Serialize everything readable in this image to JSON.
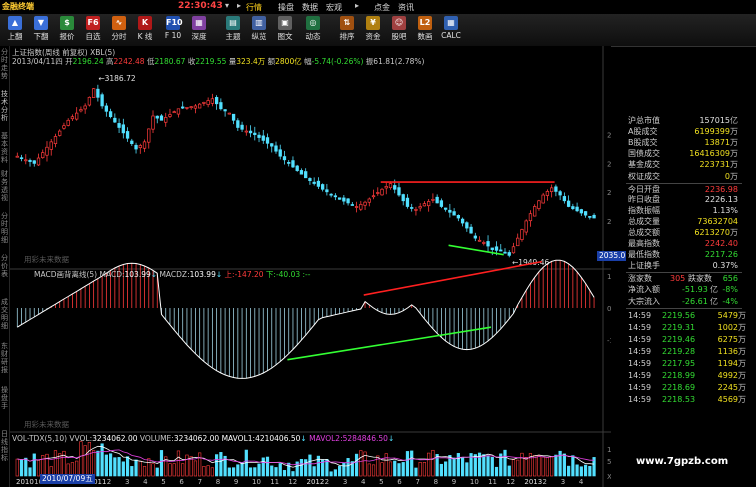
{
  "app": {
    "title": "金融终端",
    "clock": "22:30:43"
  },
  "menu": [
    {
      "label": "行情",
      "active": true
    },
    {
      "label": "操盘",
      "active": false
    },
    {
      "label": "数据",
      "active": false
    },
    {
      "label": "宏观",
      "active": false
    },
    {
      "label": "点金",
      "active": false
    },
    {
      "label": "资讯",
      "active": false
    }
  ],
  "toolbar": [
    {
      "label": "上翻",
      "icon": "page-up-icon",
      "glyph": "▲",
      "color": "#3a6fd8"
    },
    {
      "label": "下翻",
      "icon": "page-down-icon",
      "glyph": "▼",
      "color": "#3a6fd8"
    },
    {
      "label": "报价",
      "icon": "quote-icon",
      "glyph": "$",
      "color": "#2a8a3a"
    },
    {
      "label": "自选",
      "icon": "favorites-icon",
      "glyph": "F6",
      "color": "#c02020"
    },
    {
      "label": "分时",
      "icon": "timeshare-icon",
      "glyph": "∿",
      "color": "#d06010"
    },
    {
      "label": "K 线",
      "icon": "kline-icon",
      "glyph": "K",
      "color": "#b01818"
    },
    {
      "label": "F 10",
      "icon": "f10-icon",
      "glyph": "F10",
      "color": "#2050b0"
    },
    {
      "label": "深度",
      "icon": "depth-icon",
      "glyph": "▦",
      "color": "#8040a0"
    },
    {
      "label": "主题",
      "icon": "theme-icon",
      "glyph": "▤",
      "color": "#2a7a7a"
    },
    {
      "label": "纵览",
      "icon": "overview-icon",
      "glyph": "▥",
      "color": "#4060a0"
    },
    {
      "label": "图文",
      "icon": "chart-text-icon",
      "glyph": "▣",
      "color": "#606060"
    },
    {
      "label": "动态",
      "icon": "dynamic-icon",
      "glyph": "◎",
      "color": "#207040"
    },
    {
      "label": "排序",
      "icon": "sort-icon",
      "glyph": "⇅",
      "color": "#a05010"
    },
    {
      "label": "资金",
      "icon": "fund-icon",
      "glyph": "¥",
      "color": "#b08010"
    },
    {
      "label": "股吧",
      "icon": "forum-icon",
      "glyph": "☺",
      "color": "#a04040"
    },
    {
      "label": "数画",
      "icon": "draw-icon",
      "glyph": "L2",
      "color": "#c06010"
    },
    {
      "label": "CALC",
      "icon": "calculator-icon",
      "glyph": "▦",
      "color": "#3060b0"
    }
  ],
  "left_tabs": [
    "分时走势",
    "技术分析",
    "基本资料",
    "财务透视",
    "分时明细",
    "分价表",
    "成交明细",
    "东财研报",
    "操盘手",
    "日线指标"
  ],
  "chart": {
    "header_line1": "上证指数(周线 前复权) XBL(5)",
    "header_line2": {
      "date": "2013/04/11四",
      "open_label": "开",
      "open": "2196.24",
      "high_label": "高",
      "high": "2242.48",
      "low_label": "低",
      "low": "2180.67",
      "close_label": "收",
      "close": "2219.55",
      "amount_label": "量",
      "amount": "323.4万",
      "volume_label": "额",
      "volume": "2800亿",
      "change_label": "幅",
      "change": "-5.74(-0.26%)",
      "turnover_label": "振",
      "turnover": "61.81(2.78%)"
    },
    "peak_label": "3186.72",
    "trough_label": "1949.46",
    "y_ticks": [
      "2800",
      "2600",
      "2400",
      "2200"
    ],
    "current_price_tag": "2035.0",
    "watermark_main": "用彩未来数据",
    "macd_header": {
      "name": "MACD画背离线(5)",
      "macd_label": "MACD:",
      "macd": "103.99",
      "macdz_label": "MACDZ:",
      "macdz": "103.99",
      "up_label": "上:",
      "up": "-147.20",
      "down_label": "下:",
      "down": "-40.03",
      "dash": ":--"
    },
    "macd_ticks": [
      "100.0",
      "0.00",
      "-100.0"
    ],
    "watermark_macd": "用彩未来数据",
    "vol_header": {
      "name": "VOL-TDX(5,10)",
      "vvol_label": "VVOL:",
      "vvol": "3234062.00",
      "volume_label": "VOLUME:",
      "volume": "3234062.00",
      "mavol1_label": "MAVOL1:",
      "mavol1": "4210406.50",
      "mavol2_label": "MAVOL2:",
      "mavol2": "5284846.50"
    },
    "vol_ticks": [
      "10000",
      "5000",
      "X10"
    ],
    "x_labels": [
      "2010",
      "10",
      "11",
      "12",
      "2011",
      "2",
      "3",
      "4",
      "5",
      "6",
      "7",
      "8",
      "9",
      "10",
      "11",
      "12",
      "2012",
      "2",
      "3",
      "4",
      "5",
      "6",
      "7",
      "8",
      "9",
      "10",
      "11",
      "12",
      "2013",
      "2",
      "3",
      "4"
    ],
    "date_box": "2010/07/09五"
  },
  "right_panel": {
    "stats": [
      {
        "label": "沪总市值",
        "value": "157015",
        "unit": "亿",
        "color": "#e0e0e0"
      },
      {
        "label": "A股成交",
        "value": "6199399",
        "unit": "万",
        "color": "#f0e020"
      },
      {
        "label": "B股成交",
        "value": "13871",
        "unit": "万",
        "color": "#f0e020"
      },
      {
        "label": "国债成交",
        "value": "16416309",
        "unit": "万",
        "color": "#f0e020"
      },
      {
        "label": "基金成交",
        "value": "223731",
        "unit": "万",
        "color": "#f0e020"
      },
      {
        "label": "权证成交",
        "value": "0",
        "unit": "万",
        "color": "#f0e020"
      },
      {
        "label": "今日开盘",
        "value": "2236.98",
        "unit": "",
        "color": "#ff3b3b"
      },
      {
        "label": "昨日收盘",
        "value": "2226.13",
        "unit": "",
        "color": "#e0e0e0"
      },
      {
        "label": "指数振幅",
        "value": "1.13%",
        "unit": "",
        "color": "#e0e0e0"
      },
      {
        "label": "总成交量",
        "value": "73632704",
        "unit": "",
        "color": "#f0e020"
      },
      {
        "label": "总成交额",
        "value": "6213270",
        "unit": "万",
        "color": "#f0e020"
      },
      {
        "label": "最高指数",
        "value": "2242.40",
        "unit": "",
        "color": "#ff3b3b"
      },
      {
        "label": "最低指数",
        "value": "2217.26",
        "unit": "",
        "color": "#33dd33"
      },
      {
        "label": "上证换手",
        "value": "0.37%",
        "unit": "",
        "color": "#e0e0e0"
      }
    ],
    "breadth": {
      "up_label": "涨家数",
      "up": "305",
      "down_label": "跌家数",
      "down": "656"
    },
    "flows": [
      {
        "label": "净流入额",
        "value": "-51.93",
        "unit": "亿",
        "pct": "-8%"
      },
      {
        "label": "大宗流入",
        "value": "-26.61",
        "unit": "亿",
        "pct": "-4%"
      }
    ],
    "ticks": [
      {
        "time": "14:59",
        "price": "2219.56",
        "vol": "5479"
      },
      {
        "time": "14:59",
        "price": "2219.31",
        "vol": "1002"
      },
      {
        "time": "14:59",
        "price": "2219.46",
        "vol": "6275"
      },
      {
        "time": "14:59",
        "price": "2219.28",
        "vol": "1136"
      },
      {
        "time": "14:59",
        "price": "2217.95",
        "vol": "1194"
      },
      {
        "time": "14:59",
        "price": "2218.99",
        "vol": "4992"
      },
      {
        "time": "14:59",
        "price": "2218.69",
        "vol": "2245"
      },
      {
        "time": "14:59",
        "price": "2218.53",
        "vol": "4569"
      }
    ],
    "tick_unit": "万"
  },
  "watermark": "www.7gpzb.com",
  "colors": {
    "up": "#ff3b3b",
    "down": "#33dd33",
    "cyan": "#52e0ff",
    "yellow": "#f0e020",
    "blue_tag": "#1a3fa8"
  }
}
